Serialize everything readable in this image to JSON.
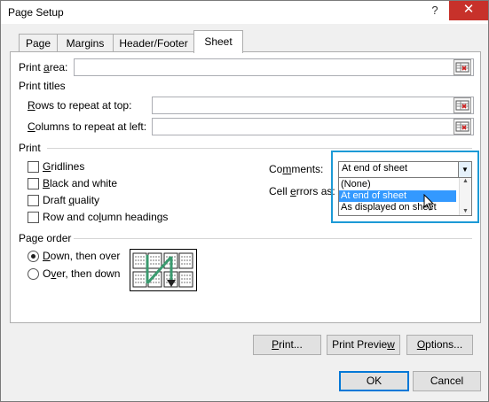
{
  "window": {
    "title": "Page Setup",
    "help_glyph": "?",
    "close_glyph": "✕"
  },
  "tabs": [
    {
      "label": "Page"
    },
    {
      "label": "Margins"
    },
    {
      "label": "Header/Footer"
    },
    {
      "label": "Sheet",
      "active": true
    }
  ],
  "print_area": {
    "label_prefix": "Print ",
    "label_key": "a",
    "label_suffix": "rea:",
    "value": ""
  },
  "print_titles": {
    "heading": "Print titles",
    "rows_label_key": "R",
    "rows_label_rest": "ows to repeat at top:",
    "rows_value": "",
    "cols_label_key": "C",
    "cols_label_rest": "olumns to repeat at left:",
    "cols_value": ""
  },
  "print": {
    "heading": "Print",
    "gridlines_key": "G",
    "gridlines_rest": "ridlines",
    "gridlines_checked": false,
    "bw_key": "B",
    "bw_rest": "lack and white",
    "bw_checked": false,
    "draft_prefix": "Draft ",
    "draft_key": "q",
    "draft_rest": "uality",
    "draft_checked": false,
    "rowcol_prefix": "Row and co",
    "rowcol_key": "l",
    "rowcol_rest": "umn headings",
    "rowcol_checked": false,
    "comments_prefix": "Co",
    "comments_key": "m",
    "comments_rest": "ments:",
    "comments_value": "At end of sheet",
    "comments_options": [
      "(None)",
      "At end of sheet",
      "As displayed on sheet"
    ],
    "comments_selected_index": 1,
    "cell_errors_prefix": "Cell ",
    "cell_errors_key": "e",
    "cell_errors_rest": "rrors as:"
  },
  "page_order": {
    "heading": "Page order",
    "down_key": "D",
    "down_rest": "own, then over",
    "down_selected": true,
    "over_key": "v",
    "over_prefix": "O",
    "over_rest": "er, then down",
    "over_selected": false
  },
  "buttons": {
    "print_key": "P",
    "print_rest": "rint...",
    "preview_prefix": "Print Previe",
    "preview_key": "w",
    "preview_rest": "",
    "options_key": "O",
    "options_rest": "ptions...",
    "ok": "OK",
    "cancel": "Cancel"
  },
  "colors": {
    "accent_highlight": "#1c9ad6",
    "list_selection": "#3399ff",
    "close_red": "#c7312a",
    "arrow_green": "#3a9a6f"
  }
}
